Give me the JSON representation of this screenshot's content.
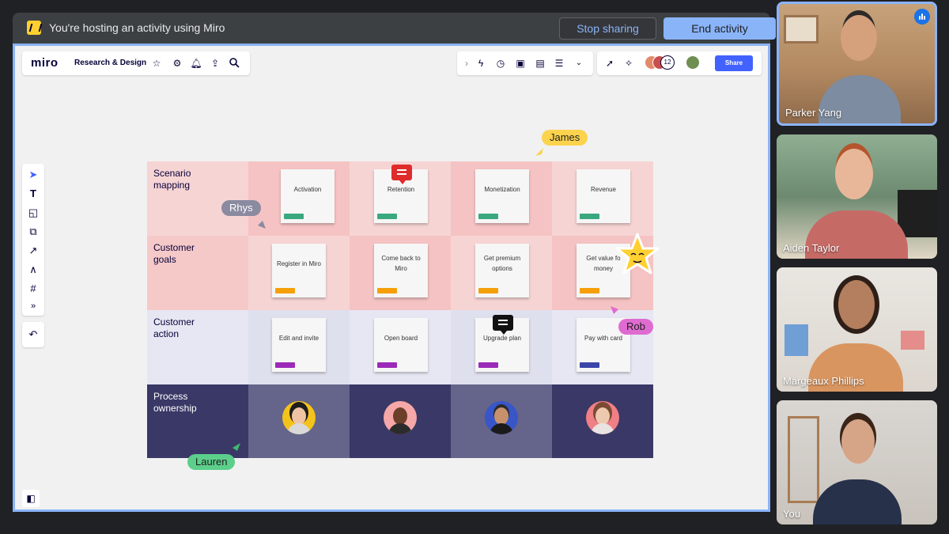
{
  "banner": {
    "message": "You're hosting an activity using Miro",
    "stop_label": "Stop sharing",
    "end_label": "End activity"
  },
  "miro": {
    "logo": "miro",
    "board_name": "Research & Design",
    "collaborator_count": "12",
    "share_label": "Share",
    "left_icons": [
      "star-icon",
      "gear-icon",
      "bell-icon",
      "upload-icon",
      "search-icon"
    ],
    "mid_icons": [
      "chevron-right-icon",
      "lightning-icon",
      "timer-icon",
      "sticky-icon",
      "present-icon",
      "notes-icon",
      "chevrons-down-icon"
    ],
    "tools": [
      "cursor-icon",
      "text-icon",
      "sticky-note-icon",
      "shapes-icon",
      "arrow-line-icon",
      "pen-icon",
      "frame-icon",
      "more-icon"
    ]
  },
  "grid": {
    "rows": [
      {
        "label": "Scenario mapping",
        "stickies": [
          {
            "text": "Activation",
            "tag": "#3aa87f"
          },
          {
            "text": "Retention",
            "tag": "#3aa87f"
          },
          {
            "text": "Monetization",
            "tag": "#3aa87f"
          },
          {
            "text": "Revenue",
            "tag": "#3aa87f"
          }
        ]
      },
      {
        "label": "Customer goals",
        "stickies": [
          {
            "text": "Register in Miro",
            "tag": "#f5a00a"
          },
          {
            "text": "Come back to Miro",
            "tag": "#f5a00a"
          },
          {
            "text": "Get premium options",
            "tag": "#f5a00a"
          },
          {
            "text": "Get value fo money",
            "tag": "#f5a00a"
          }
        ]
      },
      {
        "label": "Customer action",
        "stickies": [
          {
            "text": "Edit and invite",
            "tag": "#9c2ab8"
          },
          {
            "text": "Open board",
            "tag": "#9c2ab8"
          },
          {
            "text": "Upgrade plan",
            "tag": "#9c2ab8"
          },
          {
            "text": "Pay with card",
            "tag": "#3b46a8"
          }
        ]
      },
      {
        "label": "Process ownership"
      }
    ]
  },
  "cursors": {
    "james": "James",
    "rhys": "Rhys",
    "rob": "Rob",
    "lauren": "Lauren"
  },
  "participants": [
    {
      "name": "Parker Yang",
      "speaking": true
    },
    {
      "name": "Aiden Taylor"
    },
    {
      "name": "Margeaux Phillips"
    },
    {
      "name": "You"
    }
  ],
  "colors": {
    "accent": "#8ab4f8",
    "miro_yellow": "#ffd02f",
    "share_blue": "#4262ff",
    "row1_a": "#f7d4d4",
    "row1_b": "#f5c3c3",
    "row2_a": "#f6c9c9",
    "row2_b": "#f7d4d4",
    "row3": "#e6e7f3",
    "row4_dark": "#3a3866",
    "row4_mid": "#65648a"
  }
}
